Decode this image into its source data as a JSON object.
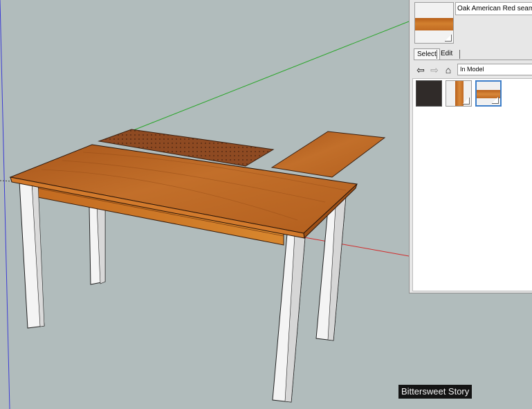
{
  "materials_panel": {
    "material_name": "Oak American Red seamless",
    "tabs": {
      "select": "Select",
      "edit": "Edit"
    },
    "nav": {
      "back_icon": "back-arrow-icon",
      "forward_icon": "forward-arrow-icon",
      "home_icon": "home-icon",
      "collection": "In Model"
    },
    "swatches": [
      {
        "name": "dark-gray-material",
        "color": "#302b29"
      },
      {
        "name": "wood-vertical-material",
        "color": "#c87227"
      },
      {
        "name": "wood-horizontal-material",
        "color": "#c87227",
        "selected": true
      }
    ]
  },
  "viewport": {
    "axis_colors": {
      "blue": "#3b3bd4",
      "green": "#2aa62a",
      "red": "#d12b2b"
    },
    "table_top_color": "#c06a22",
    "leg_color": "#f4f4f4"
  },
  "watermark": "Bittersweet Story"
}
